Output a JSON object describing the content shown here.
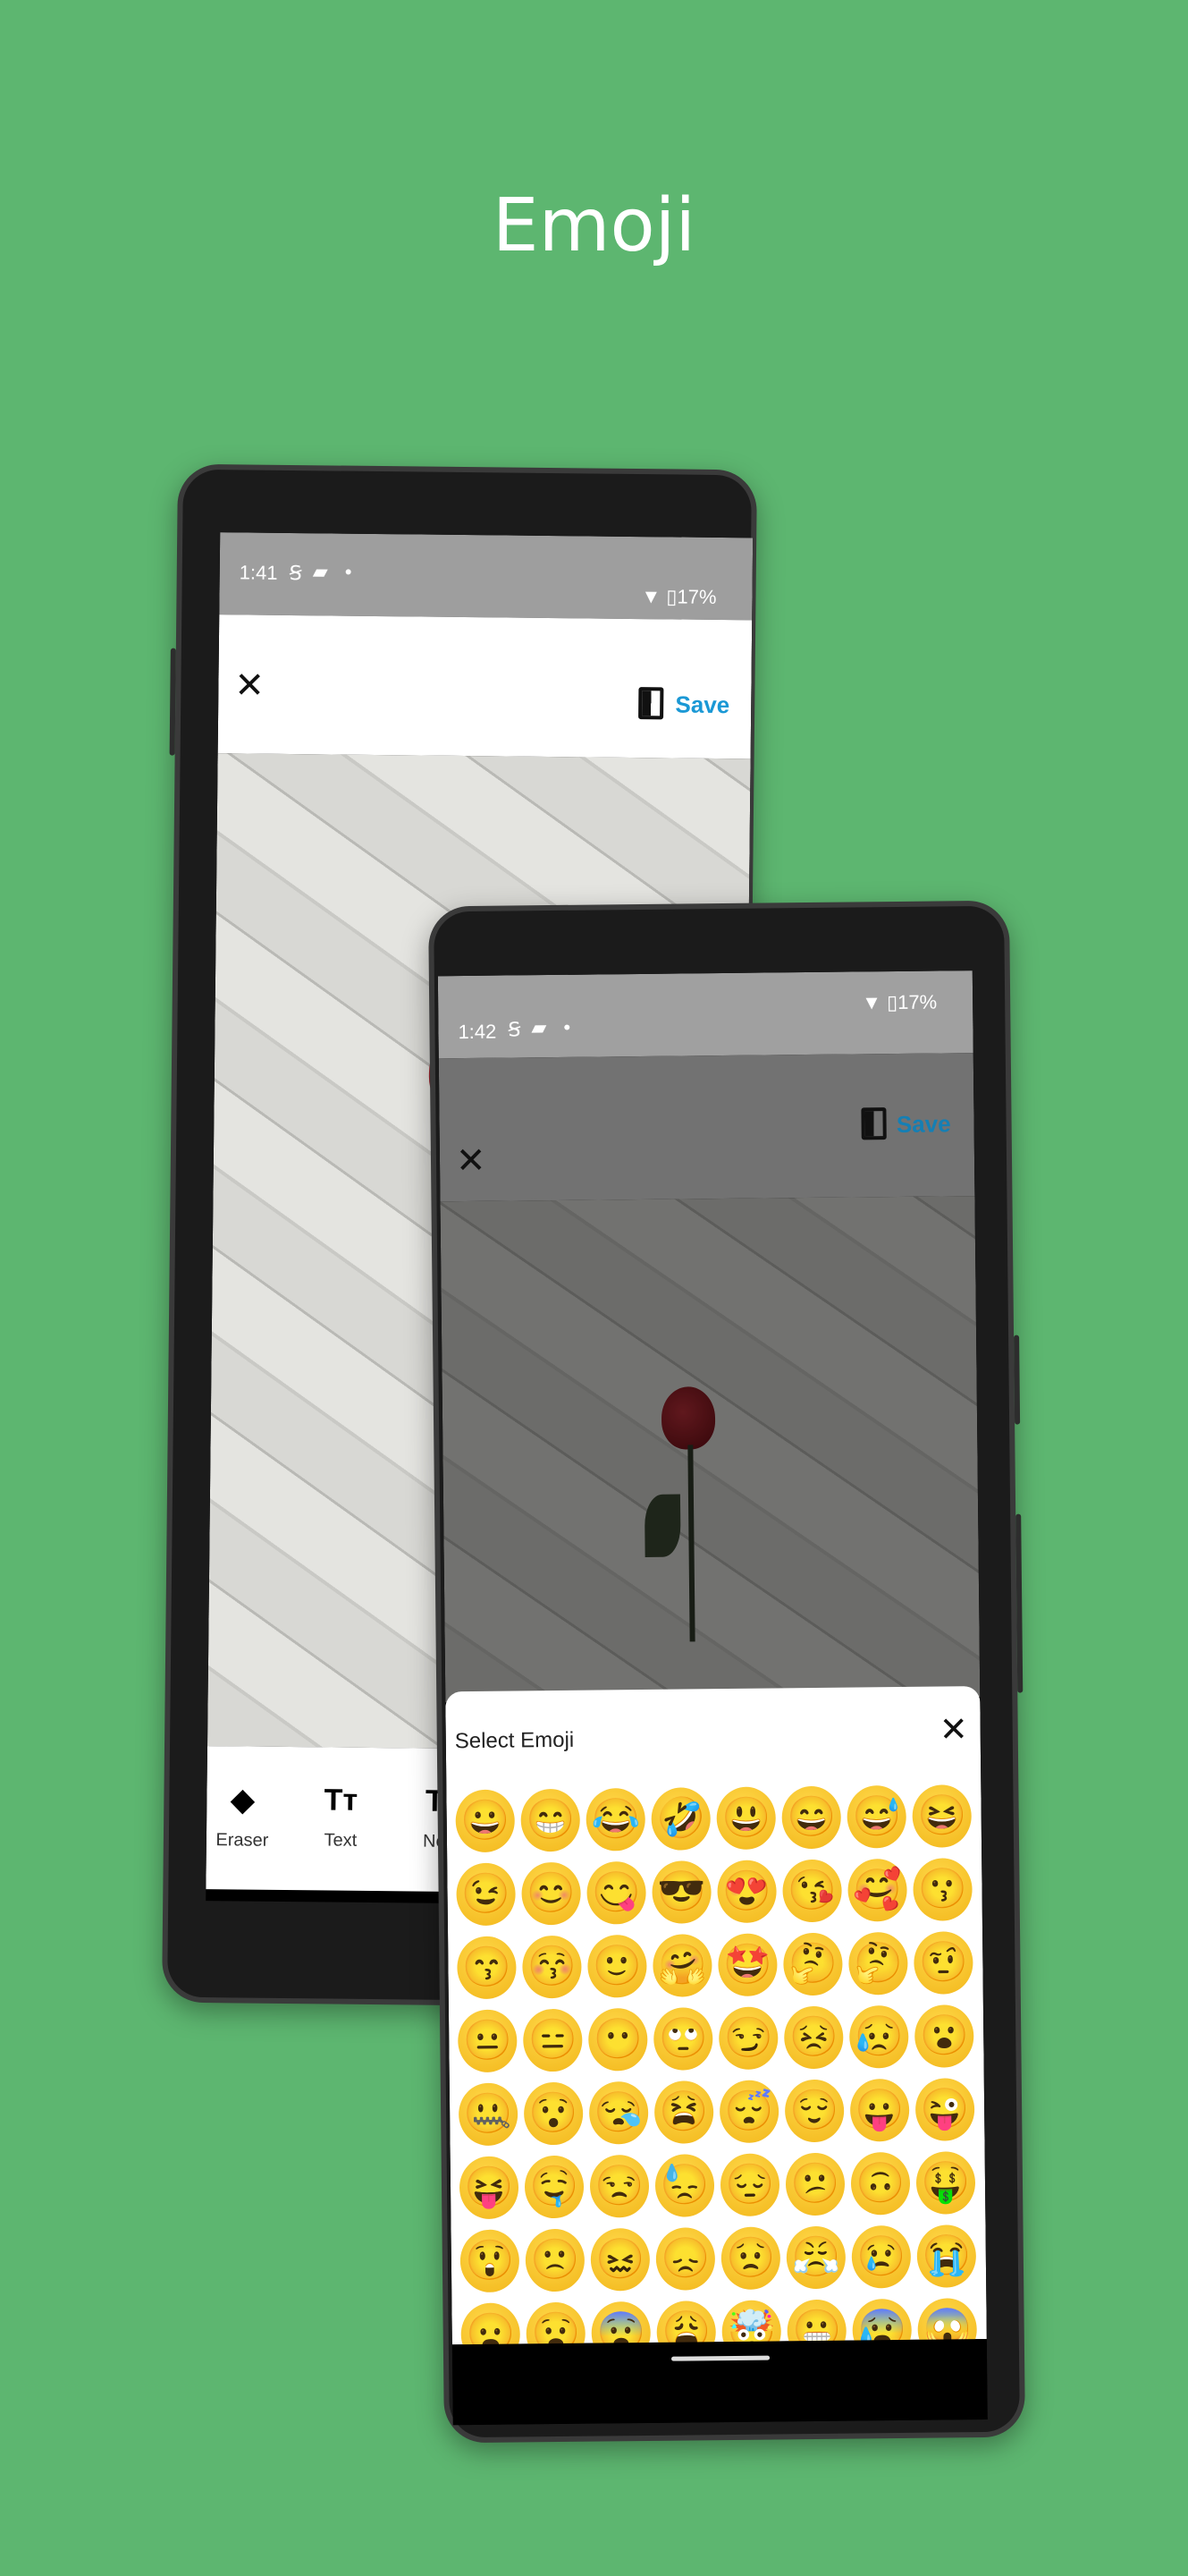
{
  "title": "Emoji",
  "colors": {
    "background": "#5db670",
    "accent": "#1a98d5"
  },
  "back_phone": {
    "status": {
      "time": "1:41",
      "icons": [
        "s-icon",
        "message-icon",
        "dot-icon"
      ],
      "wifi": "wifi-icon",
      "battery": "17%"
    },
    "toolbar": {
      "close_icon": "close-icon",
      "compare_icon": "compare-icon",
      "save_label": "Save"
    },
    "tools": [
      {
        "icon": "eraser-icon",
        "glyph": "◆",
        "label": "Eraser"
      },
      {
        "icon": "text-icon",
        "glyph": "Tт",
        "label": "Text"
      },
      {
        "icon": "neon-icon",
        "glyph": "T",
        "label": "Ne"
      }
    ]
  },
  "front_phone": {
    "status": {
      "time": "1:42",
      "icons": [
        "s-icon",
        "message-icon",
        "dot-icon"
      ],
      "wifi": "wifi-icon",
      "battery": "17%"
    },
    "toolbar": {
      "close_icon": "close-icon",
      "compare_icon": "compare-icon",
      "save_label": "Save"
    },
    "emoji_sheet": {
      "title": "Select Emoji",
      "emojis": [
        "😀",
        "😁",
        "😂",
        "🤣",
        "😃",
        "😄",
        "😅",
        "😆",
        "😉",
        "😊",
        "😋",
        "😎",
        "😍",
        "😘",
        "🥰",
        "😗",
        "😙",
        "😚",
        "🙂",
        "🤗",
        "🤩",
        "🤔",
        "🤔",
        "🤨",
        "😐",
        "😑",
        "😶",
        "🙄",
        "😏",
        "😣",
        "😥",
        "😮",
        "🤐",
        "😯",
        "😪",
        "😫",
        "😴",
        "😌",
        "😛",
        "😜",
        "😝",
        "🤤",
        "😒",
        "😓",
        "😔",
        "😕",
        "🙃",
        "🤑",
        "😲",
        "🙁",
        "😖",
        "😞",
        "😟",
        "😤",
        "😢",
        "😭",
        "😦",
        "😧",
        "😨",
        "😩",
        "🤯",
        "😬",
        "😰",
        "😱"
      ]
    }
  }
}
